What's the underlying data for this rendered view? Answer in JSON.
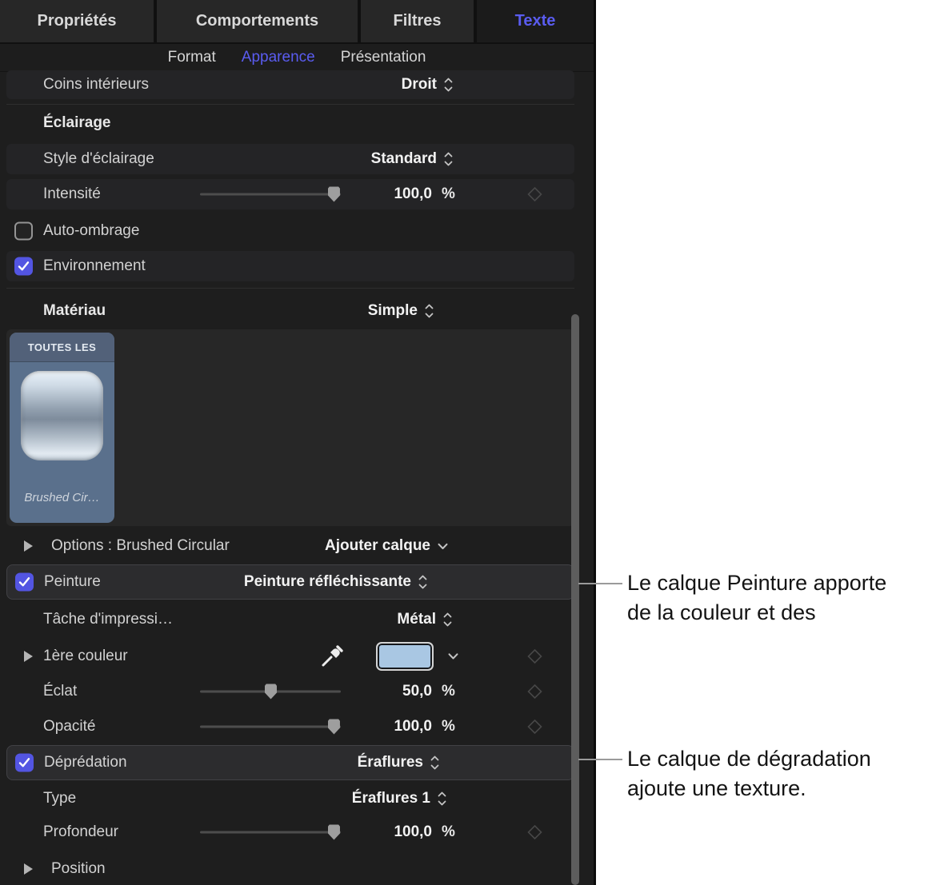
{
  "tabs": {
    "properties": "Propriétés",
    "behaviors": "Comportements",
    "filters": "Filtres",
    "text": "Texte"
  },
  "subtabs": {
    "format": "Format",
    "appearance": "Apparence",
    "layout": "Présentation"
  },
  "rows": {
    "inner_corners": {
      "label": "Coins intérieurs",
      "value": "Droit"
    },
    "lighting_header": "Éclairage",
    "lighting_style": {
      "label": "Style d'éclairage",
      "value": "Standard"
    },
    "intensity": {
      "label": "Intensité",
      "value": "100,0",
      "unit": "%",
      "percent": 100
    },
    "self_shadows": {
      "label": "Auto-ombrage",
      "checked": false
    },
    "environment": {
      "label": "Environnement",
      "checked": true
    },
    "material": {
      "label": "Matériau",
      "value": "Simple"
    },
    "material_well": {
      "selected_tab": "TOUTES LES",
      "thumb_label": "Brushed Cir…"
    },
    "options": {
      "label": "Options : Brushed Circular",
      "button": "Ajouter calque"
    },
    "paint": {
      "label": "Peinture",
      "checked": true,
      "value": "Peinture réfléchissante"
    },
    "print_job": {
      "label": "Tâche d'impressi…",
      "value": "Métal"
    },
    "first_color": {
      "label": "1ère couleur",
      "swatch_color": "#a9c7e3"
    },
    "brightness": {
      "label": "Éclat",
      "value": "50,0",
      "unit": "%",
      "percent": 50
    },
    "opacity": {
      "label": "Opacité",
      "value": "100,0",
      "unit": "%",
      "percent": 100
    },
    "distress": {
      "label": "Déprédation",
      "checked": true,
      "value": "Éraflures"
    },
    "type": {
      "label": "Type",
      "value": "Éraflures 1"
    },
    "depth": {
      "label": "Profondeur",
      "value": "100,0",
      "unit": "%",
      "percent": 100
    },
    "position": {
      "label": "Position"
    }
  },
  "callouts": {
    "paint": {
      "line1": "Le calque Peinture apporte",
      "line2": "de la couleur et des"
    },
    "distress": {
      "line1": "Le calque de dégradation",
      "line2": "ajoute une texture."
    }
  },
  "colors": {
    "accent": "#5a5cf0",
    "checkbox_fill": "#5355e2",
    "swatch": "#a9c7e3"
  }
}
